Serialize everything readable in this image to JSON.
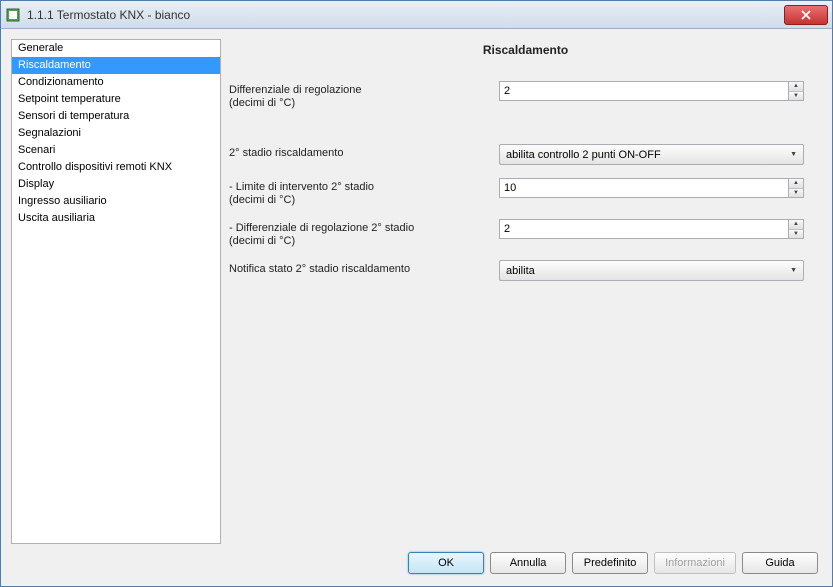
{
  "window": {
    "title": "1.1.1 Termostato KNX - bianco"
  },
  "sidebar": {
    "items": [
      {
        "label": "Generale"
      },
      {
        "label": "Riscaldamento"
      },
      {
        "label": "Condizionamento"
      },
      {
        "label": "Setpoint temperature"
      },
      {
        "label": "Sensori di temperatura"
      },
      {
        "label": "Segnalazioni"
      },
      {
        "label": "Scenari"
      },
      {
        "label": "Controllo dispositivi remoti KNX"
      },
      {
        "label": "Display"
      },
      {
        "label": "Ingresso ausiliario"
      },
      {
        "label": "Uscita ausiliaria"
      }
    ],
    "selectedIndex": 1
  },
  "panel": {
    "title": "Riscaldamento",
    "fields": {
      "diff_reg": {
        "label": "Differenziale di regolazione\n(decimi di °C)",
        "value": "2"
      },
      "second_stage": {
        "label": "2° stadio riscaldamento",
        "value": "abilita controllo 2 punti ON-OFF"
      },
      "limit_second": {
        "label": "- Limite di intervento 2° stadio\n  (decimi di °C)",
        "value": "10"
      },
      "diff_second": {
        "label": "- Differenziale di regolazione 2° stadio\n  (decimi di °C)",
        "value": "2"
      },
      "notify_second": {
        "label": "Notifica stato 2° stadio riscaldamento",
        "value": "abilita"
      }
    }
  },
  "buttons": {
    "ok": "OK",
    "cancel": "Annulla",
    "default": "Predefinito",
    "info": "Informazioni",
    "help": "Guida"
  }
}
